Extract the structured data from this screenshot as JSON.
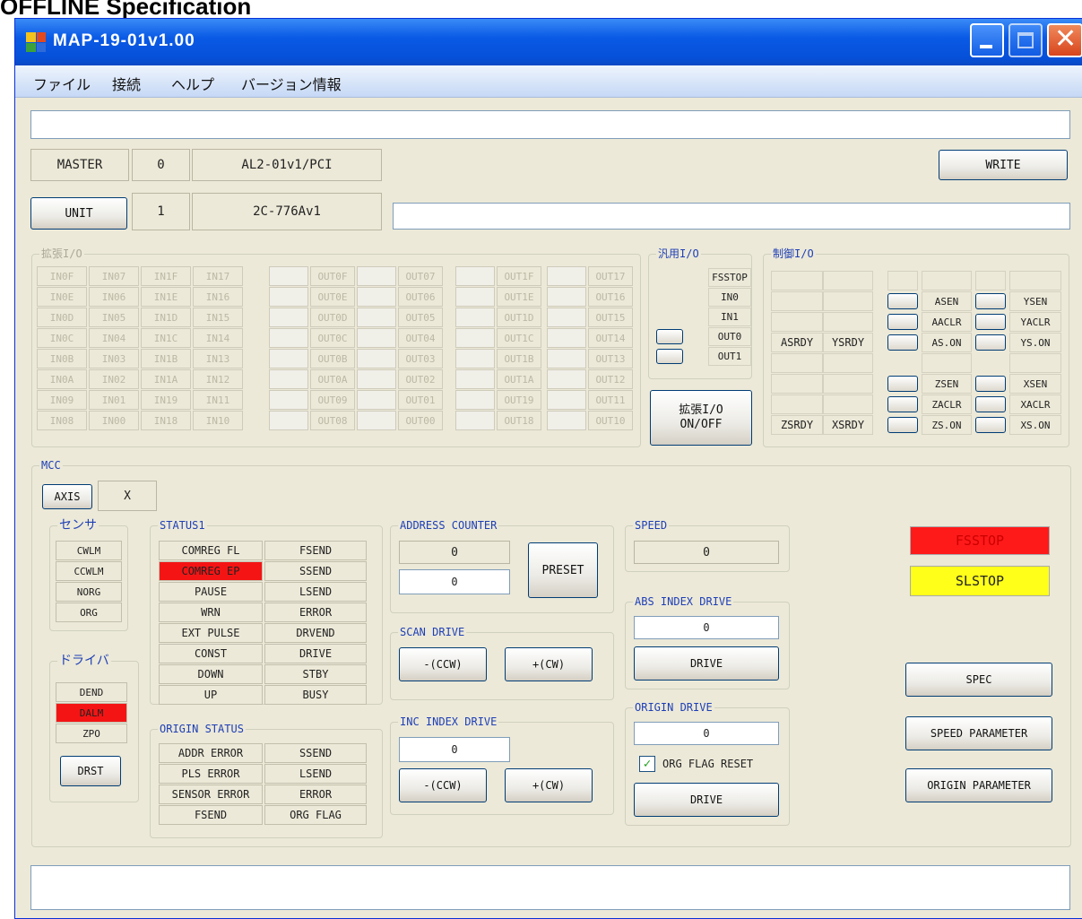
{
  "page_heading": "OFFLINE Specification",
  "window": {
    "title": "MAP-19-01v1.00"
  },
  "menu": [
    "ファイル",
    "接続",
    "ヘルプ",
    "バージョン情報"
  ],
  "top_textbox": "",
  "master": {
    "label": "MASTER",
    "num": "0",
    "name": "AL2-01v1/PCI"
  },
  "unit": {
    "button": "UNIT",
    "num": "1",
    "name": "2C-776Av1",
    "textbox": ""
  },
  "write_button": "WRITE",
  "ext_io": {
    "title": "拡張I/O",
    "in_cols": [
      [
        "IN0F",
        "IN0E",
        "IN0D",
        "IN0C",
        "IN0B",
        "IN0A",
        "IN09",
        "IN08"
      ],
      [
        "IN07",
        "IN06",
        "IN05",
        "IN04",
        "IN03",
        "IN02",
        "IN01",
        "IN00"
      ],
      [
        "IN1F",
        "IN1E",
        "IN1D",
        "IN1C",
        "IN1B",
        "IN1A",
        "IN19",
        "IN18"
      ],
      [
        "IN17",
        "IN16",
        "IN15",
        "IN14",
        "IN13",
        "IN12",
        "IN11",
        "IN10"
      ]
    ],
    "out_cols": [
      [
        "OUT0F",
        "OUT0E",
        "OUT0D",
        "OUT0C",
        "OUT0B",
        "OUT0A",
        "OUT09",
        "OUT08"
      ],
      [
        "OUT07",
        "OUT06",
        "OUT05",
        "OUT04",
        "OUT03",
        "OUT02",
        "OUT01",
        "OUT00"
      ],
      [
        "OUT1F",
        "OUT1E",
        "OUT1D",
        "OUT1C",
        "OUT1B",
        "OUT1A",
        "OUT19",
        "OUT18"
      ],
      [
        "OUT17",
        "OUT16",
        "OUT15",
        "OUT14",
        "OUT13",
        "OUT12",
        "OUT11",
        "OUT10"
      ]
    ],
    "toggle_button": "拡張I/O\nON/OFF"
  },
  "gen_io": {
    "title": "汎用I/O",
    "items": [
      "FSSTOP",
      "IN0",
      "IN1",
      "OUT0",
      "OUT1"
    ]
  },
  "ctrl_io": {
    "title": "制御I/O",
    "row_rdy": [
      "ASRDY",
      "YSRDY"
    ],
    "row_rdy2": [
      "ZSRDY",
      "XSRDY"
    ],
    "col_a": [
      "ASEN",
      "AACLR",
      "AS.ON",
      "ZSEN",
      "ZACLR",
      "ZS.ON"
    ],
    "col_b": [
      "YSEN",
      "YACLR",
      "YS.ON",
      "XSEN",
      "XACLR",
      "XS.ON"
    ]
  },
  "mcc": {
    "title": "MCC",
    "axis_button": "AXIS",
    "axis_value": "X",
    "sensor": {
      "title": "センサ",
      "items": [
        "CWLM",
        "CCWLM",
        "NORG",
        "ORG"
      ]
    },
    "driver": {
      "title": "ドライバ",
      "items": [
        "DEND",
        "DALM",
        "ZPO"
      ],
      "alarm_index": 1,
      "reset_button": "DRST"
    },
    "status1": {
      "title": "STATUS1",
      "left": [
        "COMREG FL",
        "COMREG EP",
        "PAUSE",
        "WRN",
        "EXT PULSE",
        "CONST",
        "DOWN",
        "UP"
      ],
      "right": [
        "FSEND",
        "SSEND",
        "LSEND",
        "ERROR",
        "DRVEND",
        "DRIVE",
        "STBY",
        "BUSY"
      ],
      "alarm_index": 1
    },
    "origin_status": {
      "title": "ORIGIN STATUS",
      "left": [
        "ADDR ERROR",
        "PLS ERROR",
        "SENSOR ERROR",
        "FSEND"
      ],
      "right": [
        "SSEND",
        "LSEND",
        "ERROR",
        "ORG FLAG"
      ]
    },
    "address_counter": {
      "title": "ADDRESS COUNTER",
      "value1": "0",
      "value2": "0",
      "preset_button": "PRESET"
    },
    "scan_drive": {
      "title": "SCAN DRIVE",
      "ccw_button": "-(CCW)",
      "cw_button": "+(CW)"
    },
    "inc_index_drive": {
      "title": "INC INDEX DRIVE",
      "value": "0",
      "ccw_button": "-(CCW)",
      "cw_button": "+(CW)"
    },
    "speed": {
      "title": "SPEED",
      "value": "0"
    },
    "abs_index_drive": {
      "title": "ABS INDEX DRIVE",
      "value": "0",
      "drive_button": "DRIVE"
    },
    "origin_drive": {
      "title": "ORIGIN DRIVE",
      "value": "0",
      "checkbox_label": "ORG FLAG RESET",
      "checked": true,
      "drive_button": "DRIVE"
    },
    "fsstop": "FSSTOP",
    "slstop": "SLSTOP",
    "spec_button": "SPEC",
    "speed_param_button": "SPEED PARAMETER",
    "origin_param_button": "ORIGIN PARAMETER"
  },
  "bottom_textbox": "",
  "colors": {
    "titlebar": "#0a5ae6",
    "alarm_red": "#f51414",
    "fsstop_red": "#ff1a1a",
    "slstop_yellow": "#ffff1a",
    "group_title_blue": "#1e3fb6"
  }
}
